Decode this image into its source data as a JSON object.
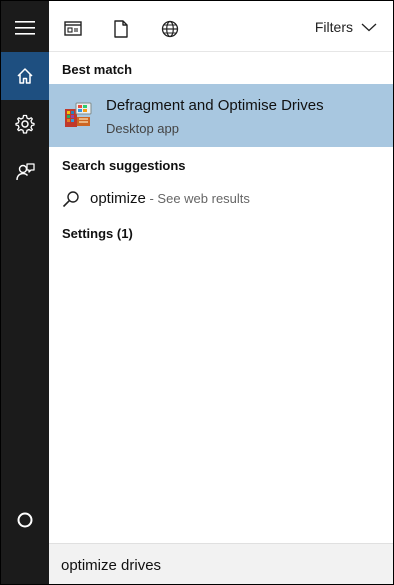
{
  "sidebar": {
    "items": [
      {
        "name": "menu",
        "icon": "hamburger-menu-icon"
      },
      {
        "name": "home",
        "icon": "home-icon",
        "active": true
      },
      {
        "name": "settings",
        "icon": "gear-icon"
      },
      {
        "name": "feedback",
        "icon": "feedback-icon"
      },
      {
        "name": "cortana",
        "icon": "cortana-circle-icon"
      }
    ]
  },
  "toolbar": {
    "icons": [
      "apps-icon",
      "document-icon",
      "web-globe-icon"
    ],
    "filters_label": "Filters"
  },
  "best_match": {
    "heading": "Best match",
    "title": "Defragment and Optimise Drives",
    "subtitle": "Desktop app",
    "icon": "defrag-app-icon"
  },
  "suggestions": {
    "heading": "Search suggestions",
    "query": "optimize",
    "hint": " - See web results"
  },
  "settings": {
    "heading": "Settings (1)"
  },
  "search": {
    "value": "optimize drives"
  },
  "colors": {
    "sidebar_bg": "#1b1b1b",
    "active_bg": "#1e4f80",
    "selection_bg": "#a8c7e0"
  }
}
